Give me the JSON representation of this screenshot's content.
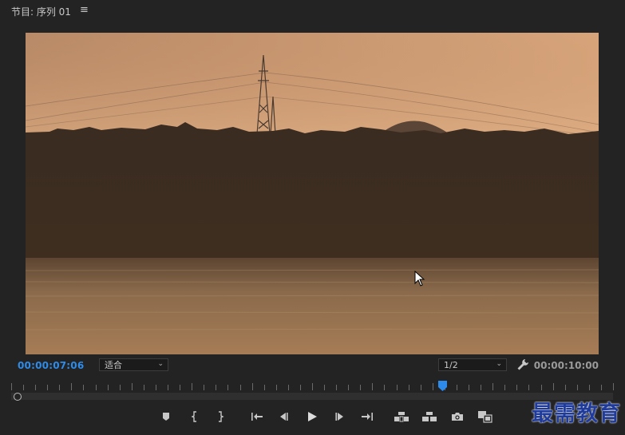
{
  "panel": {
    "title": "节目: 序列 01",
    "menu_icon": "hamburger-menu-icon"
  },
  "monitor": {
    "current_timecode": "00:00:07:06",
    "duration_timecode": "00:00:10:00",
    "fit_label": "适合",
    "resolution_label": "1/2",
    "playhead_position": 0.716
  },
  "controls": [
    {
      "name": "add-marker-button",
      "icon": "marker-icon"
    },
    {
      "name": "mark-in-button",
      "icon": "mark-in-icon"
    },
    {
      "name": "mark-out-button",
      "icon": "mark-out-icon"
    },
    {
      "name": "go-to-in-button",
      "icon": "go-to-in-icon"
    },
    {
      "name": "step-back-button",
      "icon": "step-back-icon"
    },
    {
      "name": "play-button",
      "icon": "play-icon"
    },
    {
      "name": "step-forward-button",
      "icon": "step-forward-icon"
    },
    {
      "name": "go-to-out-button",
      "icon": "go-to-out-icon"
    },
    {
      "name": "lift-button",
      "icon": "lift-icon"
    },
    {
      "name": "extract-button",
      "icon": "extract-icon"
    },
    {
      "name": "export-frame-button",
      "icon": "camera-icon"
    },
    {
      "name": "comparison-view-button",
      "icon": "comparison-view-icon"
    }
  ],
  "watermark": {
    "text": "最需教育"
  },
  "colors": {
    "background": "#232323",
    "timecode_accent": "#2d8ceb",
    "playhead": "#2d8ceb",
    "watermark": "#1f3c9c"
  }
}
